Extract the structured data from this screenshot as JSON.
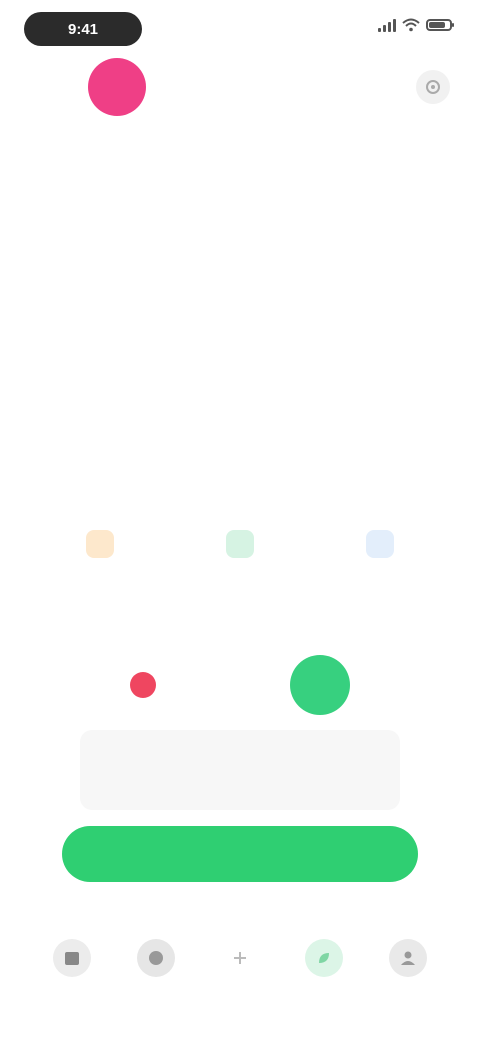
{
  "status_bar": {
    "time": "9:41"
  },
  "header": {
    "avatar_initial": "",
    "title": "",
    "avatar_color": "#ef3f86"
  },
  "calendar": {
    "month": "",
    "weekdays": [
      "",
      "",
      "",
      "",
      "",
      "",
      ""
    ],
    "weeks": [
      [
        "",
        "",
        "",
        "",
        "",
        "",
        ""
      ],
      [
        "",
        "",
        "",
        "",
        "",
        "",
        ""
      ],
      [
        "",
        "",
        "",
        "",
        "",
        "",
        ""
      ],
      [
        "",
        "",
        "",
        "",
        "",
        "",
        ""
      ],
      [
        "",
        "",
        "",
        "",
        "",
        "",
        ""
      ]
    ]
  },
  "stats": [
    {
      "value": "",
      "label": "",
      "color": "#f7b46a"
    },
    {
      "value": "",
      "label": "",
      "color": "#43c780"
    },
    {
      "value": "",
      "label": "",
      "color": "#9cc4f2"
    }
  ],
  "cycle": {
    "text": "",
    "today_value": "",
    "period_color": "#ef4660",
    "today_color": "#37d07f"
  },
  "info": {
    "text": ""
  },
  "cta": {
    "label": "",
    "color": "#2fcf72"
  },
  "nav": [
    {
      "label": "",
      "icon": "calendar-icon"
    },
    {
      "label": "",
      "icon": "chart-icon"
    },
    {
      "label": "",
      "icon": "plus-icon"
    },
    {
      "label": "",
      "icon": "leaf-icon"
    },
    {
      "label": "",
      "icon": "profile-icon"
    }
  ]
}
